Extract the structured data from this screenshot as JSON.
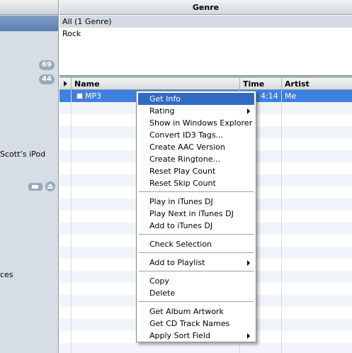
{
  "sidebar": {
    "badges": [
      "69",
      "44"
    ],
    "device_name": "Scott’s iPod",
    "partial_label": "ces"
  },
  "genre": {
    "header": "Genre",
    "items": [
      "All (1 Genre)",
      "Rock"
    ]
  },
  "track_list": {
    "columns": {
      "name": "Name",
      "time": "Time",
      "artist": "Artist"
    },
    "rows": [
      {
        "name": "MP3",
        "time": "4:14",
        "artist": "Me"
      }
    ]
  },
  "context_menu": {
    "items": [
      {
        "label": "Get Info",
        "highlighted": true
      },
      {
        "label": "Rating",
        "submenu": true
      },
      {
        "label": "Show in Windows Explorer"
      },
      {
        "label": "Convert ID3 Tags..."
      },
      {
        "label": "Create AAC Version"
      },
      {
        "label": "Create Ringtone..."
      },
      {
        "label": "Reset Play Count"
      },
      {
        "label": "Reset Skip Count"
      },
      {
        "label": "Play in iTunes DJ"
      },
      {
        "label": "Play Next in iTunes DJ"
      },
      {
        "label": "Add to iTunes DJ"
      },
      {
        "label": "Check Selection"
      },
      {
        "label": "Add to Playlist",
        "submenu": true
      },
      {
        "label": "Copy"
      },
      {
        "label": "Delete"
      },
      {
        "label": "Get Album Artwork"
      },
      {
        "label": "Get CD Track Names"
      },
      {
        "label": "Apply Sort Field",
        "submenu": true
      }
    ]
  },
  "colors": {
    "selection": "#3d80df",
    "menu_highlight": "#316ac5",
    "sidebar_bg": "#d6dde5"
  }
}
